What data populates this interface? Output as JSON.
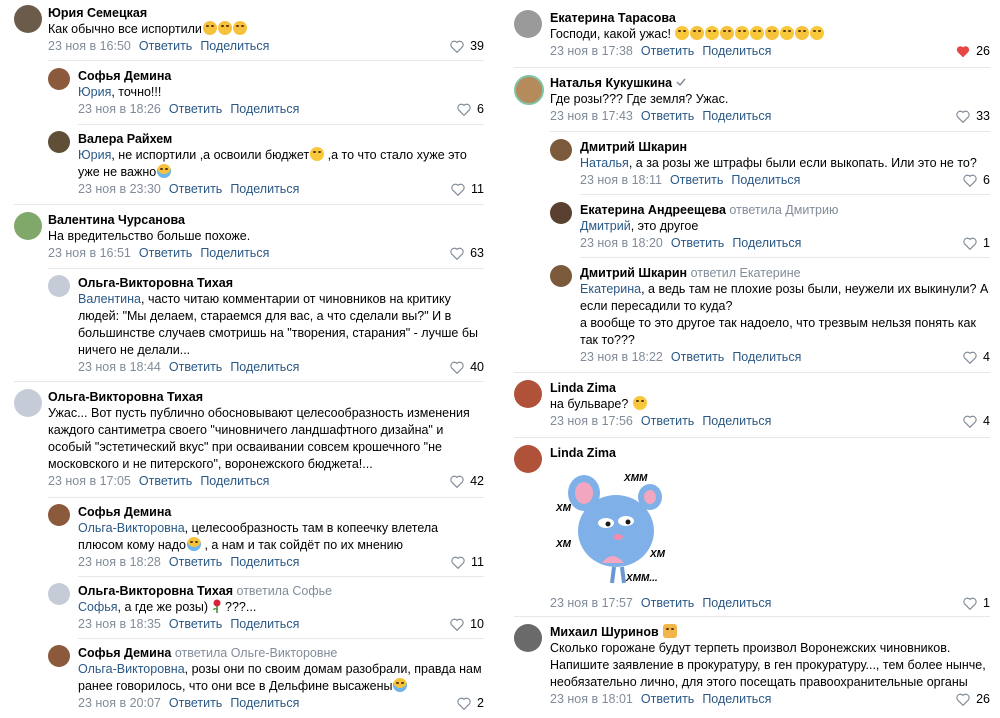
{
  "actions": {
    "reply": "Ответить",
    "share": "Поделиться"
  },
  "left": [
    {
      "name": "Юрия Семецкая",
      "note": "",
      "text": "Как обычно все испортили",
      "emoji": "cry3",
      "time": "23 ноя в 16:50",
      "likes": "39",
      "liked": false,
      "avatar": "#6b5b4a"
    },
    {
      "name": "Софья Демина",
      "note": "",
      "mention": "Юрия",
      "text": ", точно!!!",
      "emoji": "",
      "time": "23 ноя в 18:26",
      "likes": "6",
      "liked": false,
      "avatar": "#8b5a3c"
    },
    {
      "name": "Валера Райхем",
      "note": "",
      "mention": "Юрия",
      "text": ", не испортили ,а освоили бюджет",
      "text2": " ,а то что стало хуже это уже не важно",
      "emoji": "laugh",
      "time": "23 ноя в 23:30",
      "likes": "11",
      "liked": false,
      "avatar": "#5e4f36"
    },
    {
      "name": "Валентина Чурсанова",
      "note": "",
      "text": "На вредительство больше похоже.",
      "emoji": "",
      "time": "23 ноя в 16:51",
      "likes": "63",
      "liked": false,
      "avatar": "#7fa86a"
    },
    {
      "name": "Ольга-Викторовна Тихая",
      "note": "",
      "mention": "Валентина",
      "text": ", часто читаю комментарии от чиновников на критику людей: \"Мы делаем, стараемся для вас, а что сделали вы?\" И в большинстве случаев смотришь на \"творения, старания\" - лучше бы ничего не делали...",
      "emoji": "",
      "time": "23 ноя в 18:44",
      "likes": "40",
      "liked": false,
      "avatar": "#c5ccd8"
    },
    {
      "name": "Ольга-Викторовна Тихая",
      "note": "",
      "text": "Ужас... Вот пусть публично обосновывают целесообразность изменения каждого сантиметра своего \"чиновничего ландшафтного дизайна\" и особый \"эстетический вкус\" при осваивании совсем крошечного \"не московского и не питерского\", воронежского бюджета!...",
      "emoji": "",
      "time": "23 ноя в 17:05",
      "likes": "42",
      "liked": false,
      "avatar": "#c5ccd8"
    },
    {
      "name": "Софья Демина",
      "note": "",
      "mention": "Ольга-Викторовна",
      "text": ", целесообразность там в копеечку влетела плюсом кому надо",
      "text2": " , а нам и так сойдёт по их мнению",
      "emoji": "laugh",
      "time": "23 ноя в 18:28",
      "likes": "11",
      "liked": false,
      "avatar": "#8b5a3c"
    },
    {
      "name": "Ольга-Викторовна Тихая",
      "note": "ответила Софье",
      "mention": "Софья",
      "text": ", а где же розы)",
      "text2": " ???...",
      "emoji": "rose",
      "time": "23 ноя в 18:35",
      "likes": "10",
      "liked": false,
      "avatar": "#c5ccd8"
    },
    {
      "name": "Софья Демина",
      "note": "ответила Ольге-Викторовне",
      "mention": "Ольга-Викторовна",
      "text": ", розы они по своим домам разобрали, правда нам ранее говорилось, что они все в Дельфине высажены",
      "emoji": "laugh",
      "time": "23 ноя в 20:07",
      "likes": "2",
      "liked": false,
      "avatar": "#8b5a3c"
    }
  ],
  "right": [
    {
      "name": "Екатерина Тарасова",
      "note": "",
      "text": "Господи, какой ужас!",
      "emoji": "many",
      "time": "23 ноя в 17:38",
      "likes": "26",
      "liked": true,
      "avatar": "#9a9a9a"
    },
    {
      "name": "Наталья Кукушкина",
      "note": "",
      "text": "Где розы??? Где земля? Ужас.",
      "emoji": "",
      "time": "23 ноя в 17:43",
      "likes": "33",
      "liked": false,
      "avatar": "#b68b5c"
    },
    {
      "name": "Дмитрий Шкарин",
      "note": "",
      "mention": "Наталья",
      "text": ", а за розы же штрафы были если выкопать. Или это не то?",
      "emoji": "",
      "time": "23 ноя в 18:11",
      "likes": "6",
      "liked": false,
      "avatar": "#7a5a3a"
    },
    {
      "name": "Екатерина Андреещева",
      "note": "ответила Дмитрию",
      "mention": "Дмитрий",
      "text": ", это другое",
      "emoji": "",
      "time": "23 ноя в 18:20",
      "likes": "1",
      "liked": false,
      "avatar": "#5a4030"
    },
    {
      "name": "Дмитрий Шкарин",
      "note": "ответил Екатерине",
      "mention": "Екатерина",
      "text": ", а ведь там не плохие розы были, неужели их выкинули? А если пересадили то куда?",
      "text2": "а вообще то это другое так надоело, что трезвым нельзя понять как так то???",
      "emoji": "",
      "time": "23 ноя в 18:22",
      "likes": "4",
      "liked": false,
      "avatar": "#7a5a3a"
    },
    {
      "name": "Linda Zima",
      "note": "",
      "text": "на бульваре?",
      "emoji": "think",
      "time": "23 ноя в 17:56",
      "likes": "4",
      "liked": false,
      "avatar": "#b0523a"
    },
    {
      "name": "Linda Zima",
      "note": "",
      "sticker_words": [
        "ХММ",
        "ХМ",
        "ХМ",
        "ХМ",
        "ХММ..."
      ],
      "time": "23 ноя в 17:57",
      "likes": "1",
      "liked": false,
      "avatar": "#b0523a"
    },
    {
      "name": "Михаил Шуринов",
      "note": "",
      "text": "Сколько горожане будут терпеть произвол Воронежских чиновников. Напишите заявление в прокуратуру, в ген прокуратуру..., тем более нынче, необязательно лично, для этого посещать правоохранительные органы",
      "emoji": "",
      "time": "23 ноя в 18:01",
      "likes": "26",
      "liked": false,
      "avatar": "#6a6a6a"
    }
  ],
  "colors": {
    "link": "#2a5885",
    "meta": "#818c99",
    "like_red": "#e64646",
    "separator": "#e7e8ec"
  }
}
